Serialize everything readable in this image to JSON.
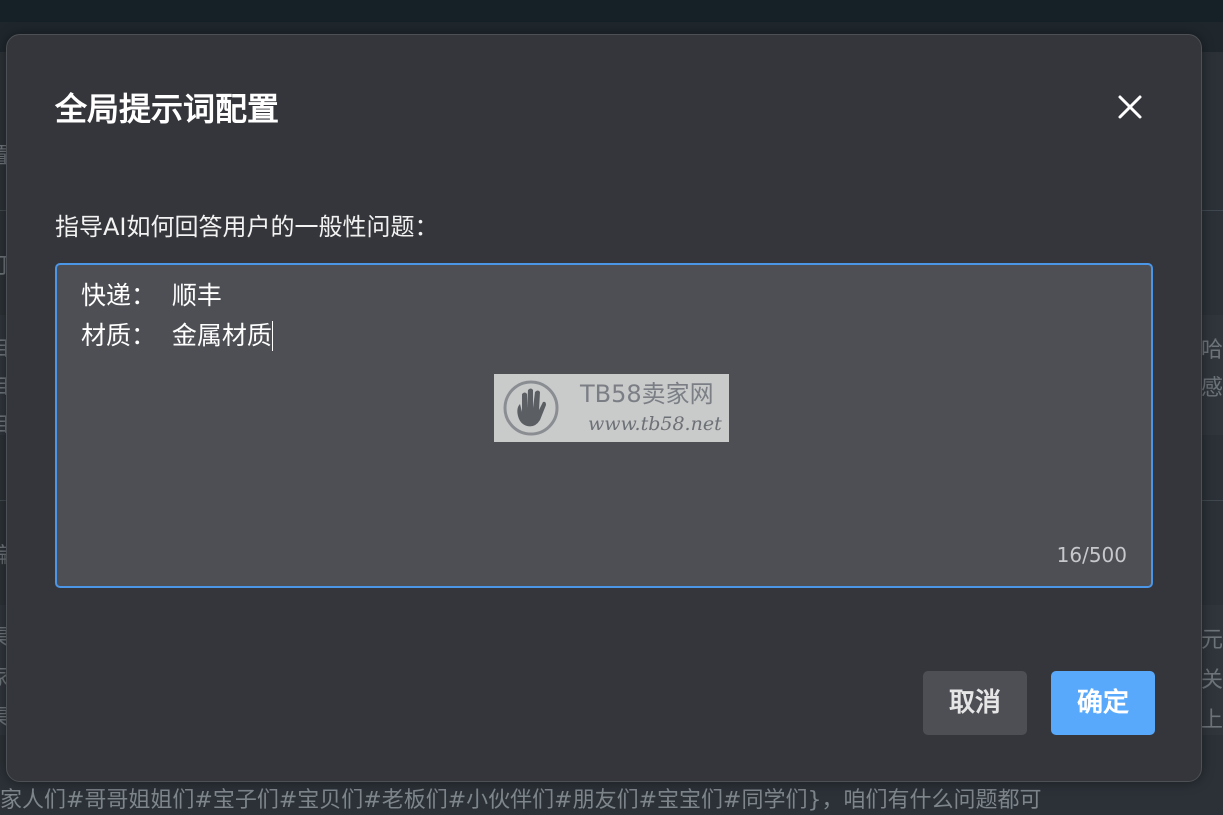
{
  "background": {
    "bottom_text": "家人们#哥哥姐姐们#宝子们#宝贝们#老板们#小伙伴们#朋友们#宝宝们#同学们}，咱们有什么问题都可",
    "right_fragments": [
      "哈",
      "感",
      "元",
      "关注",
      "上大"
    ],
    "left_fragments": [
      "置",
      "订",
      "自",
      "自",
      "自",
      "编",
      "渠",
      "家",
      "渠"
    ]
  },
  "modal": {
    "title": "全局提示词配置",
    "close_label": "×",
    "field_label": "指导AI如何回答用户的一般性问题：",
    "textarea": {
      "lines": [
        "快递：  顺丰",
        "材质：  金属材质"
      ],
      "char_count": "16/500"
    },
    "watermark": {
      "brand": "TB58卖家网",
      "url": "www.tb58.net"
    },
    "buttons": {
      "cancel": "取消",
      "confirm": "确定"
    }
  },
  "colors": {
    "modal_bg": "#35363b",
    "textarea_bg": "#4e4f55",
    "textarea_border": "#4b96e6",
    "confirm_bg": "#58a9fb",
    "cancel_bg": "#4e4f55"
  }
}
